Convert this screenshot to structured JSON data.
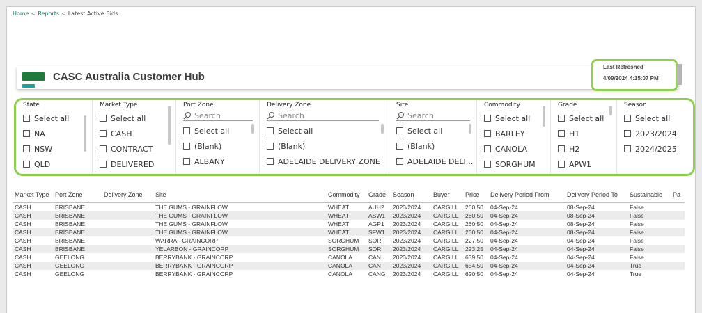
{
  "breadcrumb": {
    "home": "Home",
    "reports": "Reports",
    "current": "Latest Active Bids",
    "sep": "<"
  },
  "header": {
    "title": "CASC Australia Customer Hub",
    "refresh_label": "Last Refreshed",
    "refresh_value": "4/09/2024 4:15:07 PM"
  },
  "colors": {
    "brand_green": "#1f7a3b",
    "brand_teal": "#19a596",
    "highlight": "#8fd14f",
    "link": "#117865"
  },
  "filters": {
    "state": {
      "title": "State",
      "items": [
        "Select all",
        "NA",
        "NSW",
        "QLD"
      ]
    },
    "market_type": {
      "title": "Market Type",
      "items": [
        "Select all",
        "CASH",
        "CONTRACT",
        "DELIVERED"
      ]
    },
    "port_zone": {
      "title": "Port Zone",
      "search": "Search",
      "items": [
        "Select all",
        "(Blank)",
        "ALBANY"
      ]
    },
    "delivery_zone": {
      "title": "Delivery Zone",
      "search": "Search",
      "items": [
        "Select all",
        "(Blank)",
        "ADELAIDE DELIVERY ZONE"
      ]
    },
    "site": {
      "title": "Site",
      "search": "Search",
      "items": [
        "Select all",
        "(Blank)",
        "ADELAIDE DELI..."
      ]
    },
    "commodity": {
      "title": "Commodity",
      "items": [
        "Select all",
        "BARLEY",
        "CANOLA",
        "SORGHUM"
      ]
    },
    "grade": {
      "title": "Grade",
      "items": [
        "Select all",
        "H1",
        "H2",
        "APW1"
      ]
    },
    "season": {
      "title": "Season",
      "items": [
        "Select all",
        "2023/2024",
        "2024/2025"
      ]
    }
  },
  "table": {
    "headers": [
      "Market Type",
      "Port Zone",
      "Delivery Zone",
      "Site",
      "Commodity",
      "Grade",
      "Season",
      "Buyer",
      "Price",
      "Delivery Period From",
      "Delivery Period To",
      "Sustainable",
      "Pa"
    ],
    "rows": [
      [
        "CASH",
        "BRISBANE",
        "",
        "THE GUMS - GRAINFLOW",
        "WHEAT",
        "AUH2",
        "2023/2024",
        "CARGILL",
        "260.50",
        "04-Sep-24",
        "08-Sep-24",
        "False",
        ""
      ],
      [
        "CASH",
        "BRISBANE",
        "",
        "THE GUMS - GRAINFLOW",
        "WHEAT",
        "ASW1",
        "2023/2024",
        "CARGILL",
        "260.50",
        "04-Sep-24",
        "08-Sep-24",
        "False",
        ""
      ],
      [
        "CASH",
        "BRISBANE",
        "",
        "THE GUMS - GRAINFLOW",
        "WHEAT",
        "AGP1",
        "2023/2024",
        "CARGILL",
        "260.50",
        "04-Sep-24",
        "08-Sep-24",
        "False",
        ""
      ],
      [
        "CASH",
        "BRISBANE",
        "",
        "THE GUMS - GRAINFLOW",
        "WHEAT",
        "SFW1",
        "2023/2024",
        "CARGILL",
        "260.50",
        "04-Sep-24",
        "08-Sep-24",
        "False",
        ""
      ],
      [
        "CASH",
        "BRISBANE",
        "",
        "WARRA - GRAINCORP",
        "SORGHUM",
        "SOR",
        "2023/2024",
        "CARGILL",
        "227.50",
        "04-Sep-24",
        "04-Sep-24",
        "False",
        ""
      ],
      [
        "CASH",
        "BRISBANE",
        "",
        "YELARBON - GRAINCORP",
        "SORGHUM",
        "SOR",
        "2023/2024",
        "CARGILL",
        "223.25",
        "04-Sep-24",
        "04-Sep-24",
        "False",
        ""
      ],
      [
        "CASH",
        "GEELONG",
        "",
        "BERRYBANK - GRAINCORP",
        "CANOLA",
        "CAN",
        "2023/2024",
        "CARGILL",
        "639.50",
        "04-Sep-24",
        "04-Sep-24",
        "False",
        ""
      ],
      [
        "CASH",
        "GEELONG",
        "",
        "BERRYBANK - GRAINCORP",
        "CANOLA",
        "CAN",
        "2023/2024",
        "CARGILL",
        "654.50",
        "04-Sep-24",
        "04-Sep-24",
        "True",
        ""
      ],
      [
        "CASH",
        "GEELONG",
        "",
        "BERRYBANK - GRAINCORP",
        "CANOLA",
        "CANG",
        "2023/2024",
        "CARGILL",
        "620.50",
        "04-Sep-24",
        "04-Sep-24",
        "True",
        ""
      ]
    ]
  }
}
